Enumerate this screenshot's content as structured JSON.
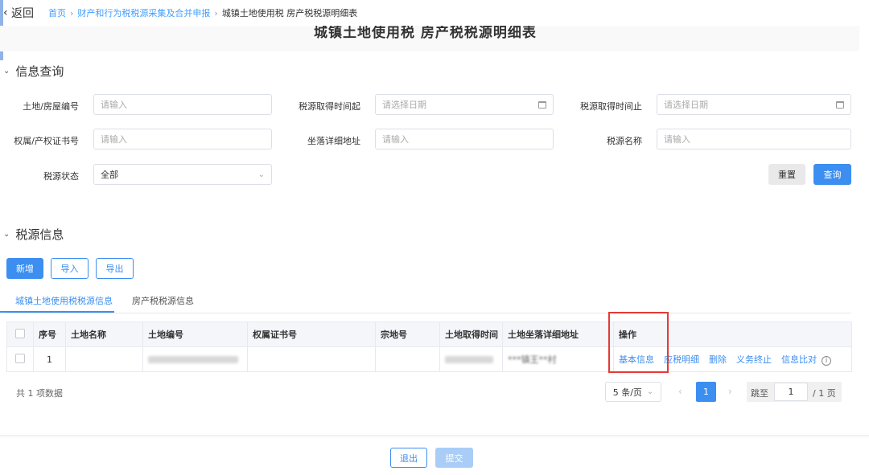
{
  "topbar": {
    "back_arrow": "‹",
    "back_label": "返回",
    "breadcrumb": [
      "首页",
      "财产和行为税税源采集及合并申报",
      "城镇土地使用税 房产税税源明细表"
    ],
    "separator": "›"
  },
  "page_title": "城镇土地使用税 房产税税源明细表",
  "query_section": {
    "title": "信息查询",
    "fields": {
      "land_no": {
        "label": "土地/房屋编号",
        "placeholder": "请输入"
      },
      "acq_start": {
        "label": "税源取得时间起",
        "placeholder": "请选择日期"
      },
      "acq_end": {
        "label": "税源取得时间止",
        "placeholder": "请选择日期"
      },
      "cert_no": {
        "label": "权属/产权证书号",
        "placeholder": "请输入"
      },
      "address": {
        "label": "坐落详细地址",
        "placeholder": "请输入"
      },
      "source_name": {
        "label": "税源名称",
        "placeholder": "请输入"
      },
      "status": {
        "label": "税源状态",
        "value": "全部"
      }
    },
    "reset_label": "重置",
    "query_label": "查询"
  },
  "source_section": {
    "title": "税源信息",
    "add_label": "新增",
    "import_label": "导入",
    "export_label": "导出",
    "tabs": [
      "城镇土地使用税税源信息",
      "房产税税源信息"
    ],
    "active_tab": 0
  },
  "table": {
    "headers": [
      "序号",
      "土地名称",
      "土地编号",
      "权属证书号",
      "宗地号",
      "土地取得时间",
      "土地坐落详细地址",
      "操作"
    ],
    "rows": [
      {
        "index": "1",
        "address_partial": "***镇王**村"
      }
    ],
    "actions": [
      "基本信息",
      "应税明细",
      "删除",
      "义务终止",
      "信息比对"
    ]
  },
  "pagination": {
    "total_text": "共 1 项数据",
    "page_size": "5 条/页",
    "current_page": "1",
    "jump_label": "跳至",
    "jump_value": "1",
    "page_total": "/ 1 页"
  },
  "footer": {
    "exit_label": "退出",
    "submit_label": "提交"
  },
  "colors": {
    "primary": "#3c8ef0",
    "highlight": "#e53935"
  }
}
